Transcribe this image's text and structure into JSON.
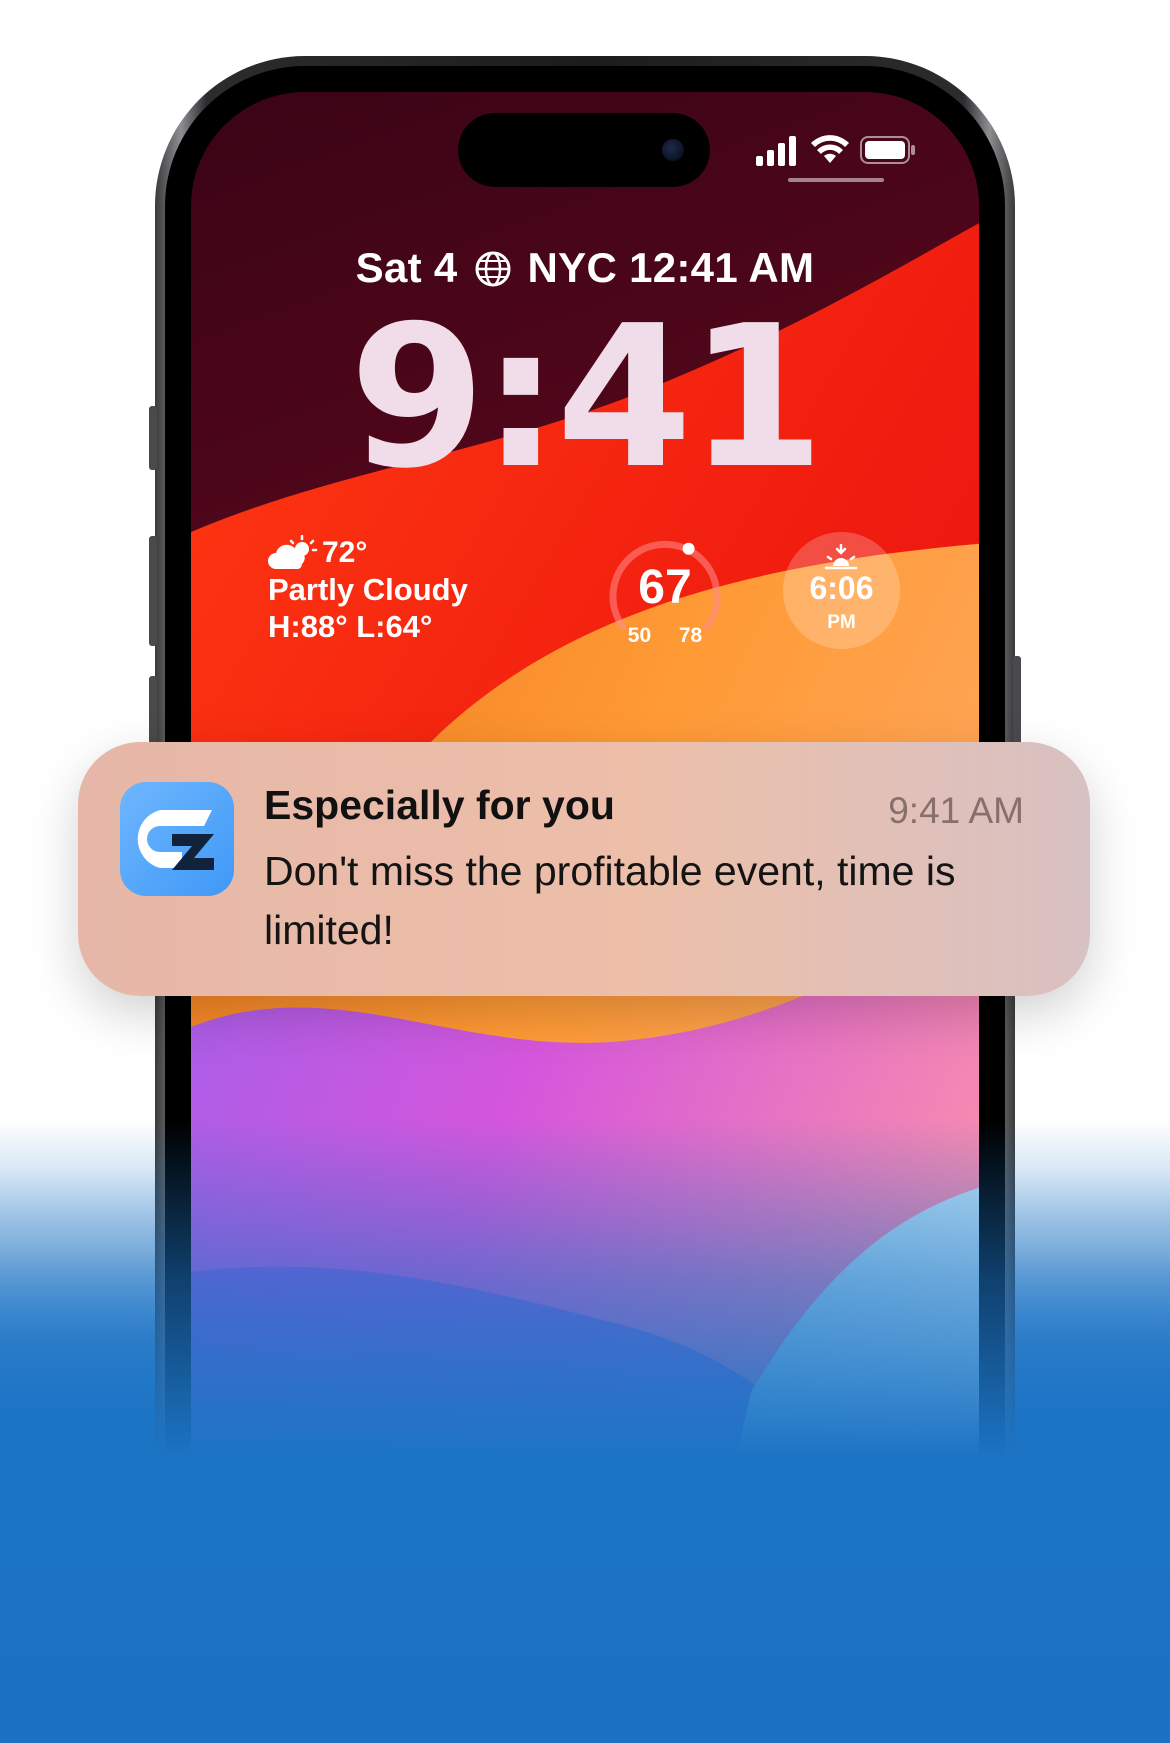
{
  "lock_screen": {
    "status_bar": {
      "icons": [
        "cellular-signal-icon",
        "wifi-icon",
        "battery-icon"
      ]
    },
    "date_line": {
      "date": "Sat 4",
      "world_clock": "NYC 12:41 AM"
    },
    "clock": "9:41",
    "weather_widget": {
      "icon": "partly-cloudy-icon",
      "temperature": "72°",
      "condition": "Partly Cloudy",
      "high_low": "H:88° L:64°"
    },
    "temperature_gauge": {
      "current": "67",
      "low": "50",
      "high": "78",
      "level": 0.6
    },
    "sunset_widget": {
      "icon": "sunset-icon",
      "time": "6:06",
      "period": "PM"
    }
  },
  "notification": {
    "app_icon": "app-logo-icon",
    "title": "Especially for you",
    "time": "9:41 AM",
    "body": "Don't miss the profitable event, time is limited!"
  },
  "colors": {
    "page_background_bottom": "#1b71c3",
    "notification_background": "#edbfa9"
  }
}
